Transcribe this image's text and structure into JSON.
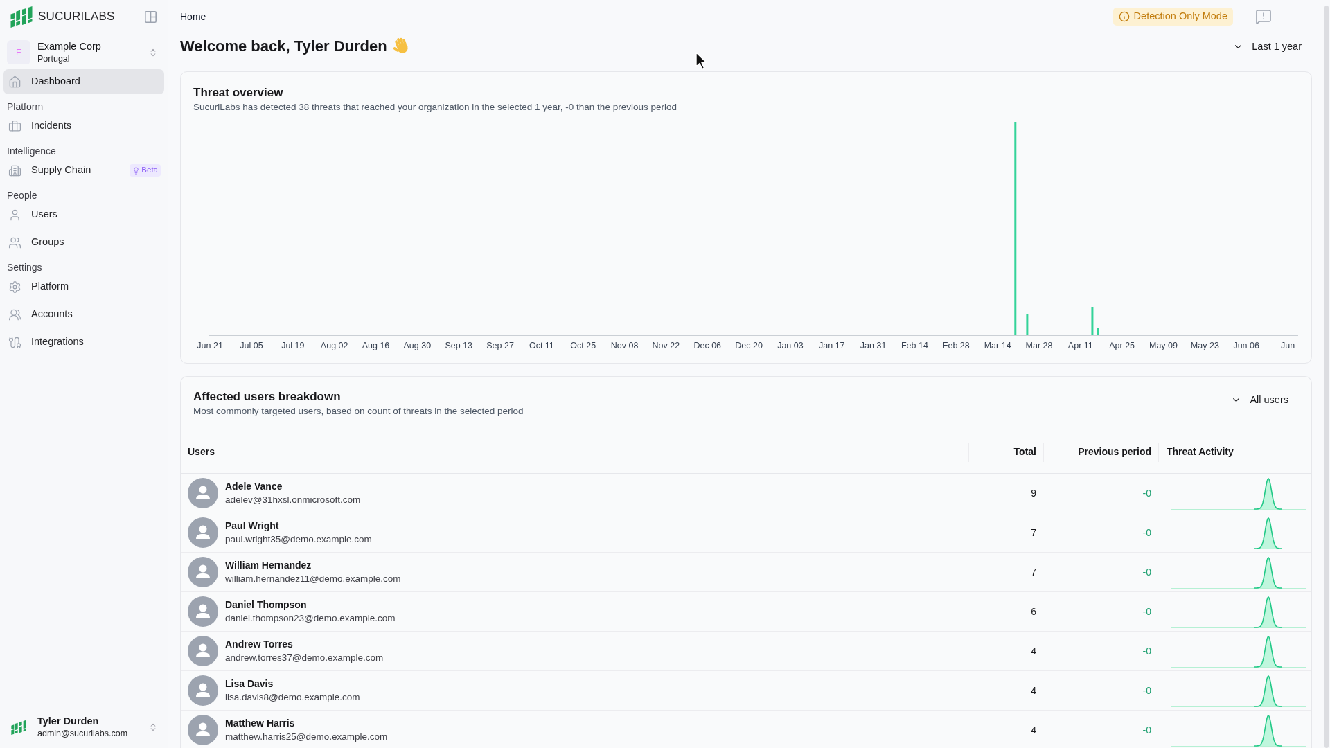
{
  "sidebar": {
    "brand": "SUCURILABS",
    "organization": {
      "avatar_letter": "E",
      "name": "Example Corp",
      "location": "Portugal"
    },
    "nav": [
      {
        "label": "Dashboard",
        "selected": true
      }
    ],
    "groups": [
      {
        "title": "Platform",
        "items": [
          {
            "label": "Incidents",
            "selected": false
          }
        ]
      },
      {
        "title": "Intelligence",
        "items": [
          {
            "label": "Supply Chain",
            "selected": false,
            "badge": "Beta"
          }
        ]
      },
      {
        "title": "People",
        "items": [
          {
            "label": "Users",
            "selected": false
          },
          {
            "label": "Groups",
            "selected": false
          }
        ]
      },
      {
        "title": "Settings",
        "items": [
          {
            "label": "Platform",
            "selected": false
          },
          {
            "label": "Accounts",
            "selected": false
          },
          {
            "label": "Integrations",
            "selected": false
          }
        ]
      }
    ],
    "user": {
      "name": "Tyler Durden",
      "email": "admin@sucurilabs.com"
    }
  },
  "header": {
    "breadcrumb": "Home",
    "mode_badge": "Detection Only Mode"
  },
  "page": {
    "title": "Welcome back, Tyler Durden",
    "period": "Last 1 year"
  },
  "threat_overview": {
    "title": "Threat overview",
    "subtitle": "SucuriLabs has detected 38 threats that reached your organization in the selected 1 year, -0 than the previous period",
    "timeline_labels": [
      "Jun 21",
      "Jul 05",
      "Jul 19",
      "Aug 02",
      "Aug 16",
      "Aug 30",
      "Sep 13",
      "Sep 27",
      "Oct 11",
      "Oct 25",
      "Nov 08",
      "Nov 22",
      "Dec 06",
      "Dec 20",
      "Jan 03",
      "Jan 17",
      "Jan 31",
      "Feb 14",
      "Feb 28",
      "Mar 14",
      "Mar 28",
      "Apr 11",
      "Apr 25",
      "May 09",
      "May 23",
      "Jun 06",
      "Jun"
    ]
  },
  "affected_users": {
    "title": "Affected users breakdown",
    "subtitle": "Most commonly targeted users, based on count of threats in the selected period",
    "filter": "All users",
    "table": {
      "columns": [
        "Users",
        "Total",
        "Previous period",
        "Threat Activity"
      ],
      "rows": [
        {
          "name": "Adele Vance",
          "email": "adelev@31hxsl.onmicrosoft.com",
          "total": "9",
          "previous": "-0"
        },
        {
          "name": "Paul Wright",
          "email": "paul.wright35@demo.example.com",
          "total": "7",
          "previous": "-0"
        },
        {
          "name": "William Hernandez",
          "email": "william.hernandez11@demo.example.com",
          "total": "7",
          "previous": "-0"
        },
        {
          "name": "Daniel Thompson",
          "email": "daniel.thompson23@demo.example.com",
          "total": "6",
          "previous": "-0"
        },
        {
          "name": "Andrew Torres",
          "email": "andrew.torres37@demo.example.com",
          "total": "4",
          "previous": "-0"
        },
        {
          "name": "Lisa Davis",
          "email": "lisa.davis8@demo.example.com",
          "total": "4",
          "previous": "-0"
        },
        {
          "name": "Matthew Harris",
          "email": "matthew.harris25@demo.example.com",
          "total": "4",
          "previous": "-0"
        }
      ]
    }
  }
}
